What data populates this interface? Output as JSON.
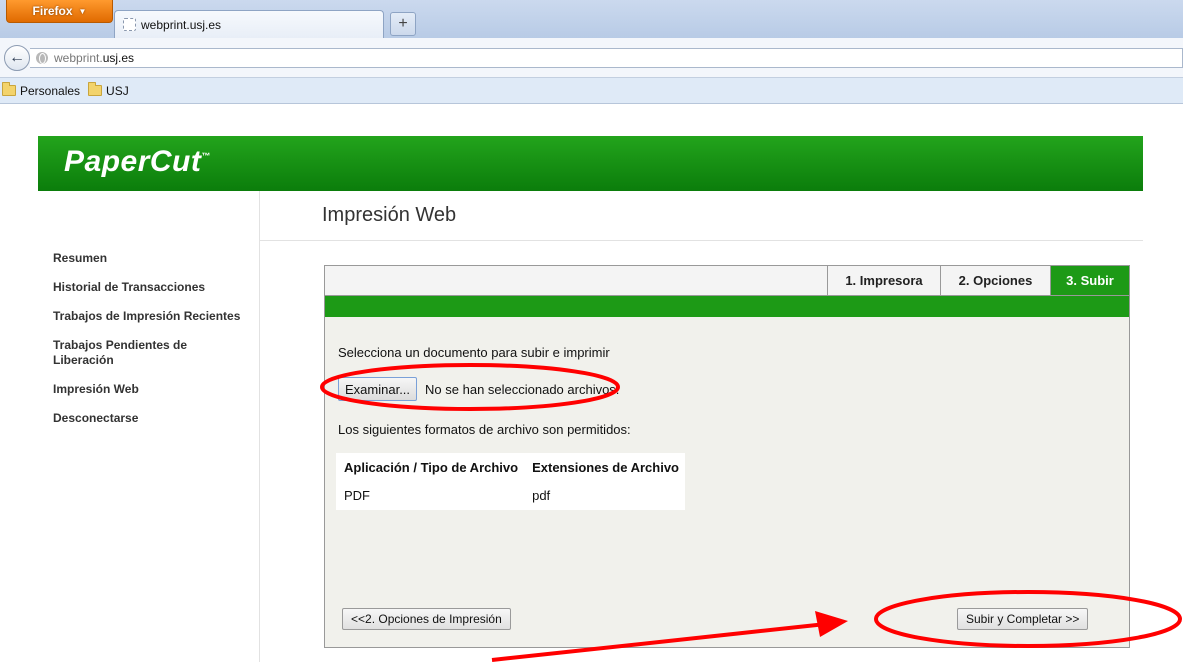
{
  "browser": {
    "app_button": "Firefox",
    "tab_title": "webprint.usj.es",
    "new_tab": "+",
    "url_host": "webprint.",
    "url_domain": "usj.es",
    "bookmarks": [
      "Personales",
      "USJ"
    ]
  },
  "brand": {
    "logo": "PaperCut",
    "tm": "™"
  },
  "sidebar": {
    "items": [
      "Resumen",
      "Historial de Transacciones",
      "Trabajos de Impresión Recientes",
      "Trabajos Pendientes de Liberación",
      "Impresión Web",
      "Desconectarse"
    ]
  },
  "page": {
    "title": "Impresión Web"
  },
  "wizard": {
    "steps": [
      "1. Impresora",
      "2. Opciones",
      "3. Subir"
    ],
    "active_step": 3,
    "intro": "Selecciona un documento para subir e imprimir",
    "browse_label": "Examinar...",
    "no_file": "No se han seleccionado archivos.",
    "formats_intro": "Los siguientes formatos de archivo son permitidos:",
    "table": {
      "headers": [
        "Aplicación / Tipo de Archivo",
        "Extensiones de Archivo"
      ],
      "rows": [
        [
          "PDF",
          "pdf"
        ]
      ]
    },
    "prev_button": "<<2. Opciones de Impresión",
    "next_button": "Subir y Completar >>"
  },
  "colors": {
    "brand_green": "#1d9a16",
    "annotation_red": "#ff0000"
  }
}
